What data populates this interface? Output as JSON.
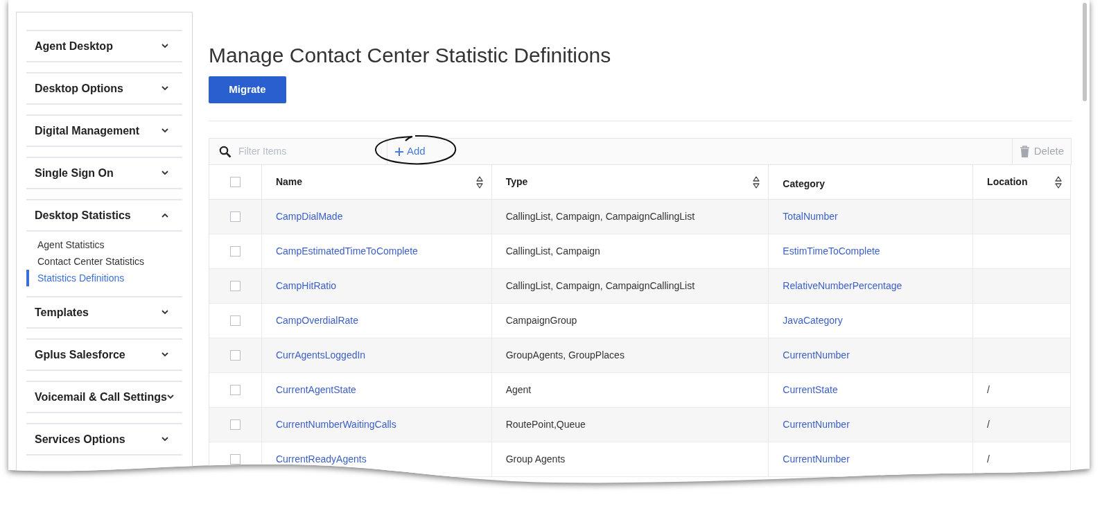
{
  "sidebar": {
    "sections": [
      {
        "label": "Agent Desktop",
        "expanded": false
      },
      {
        "label": "Desktop Options",
        "expanded": false
      },
      {
        "label": "Digital Management",
        "expanded": false
      },
      {
        "label": "Single Sign On",
        "expanded": false
      },
      {
        "label": "Desktop Statistics",
        "expanded": true,
        "children": [
          {
            "label": "Agent Statistics",
            "selected": false
          },
          {
            "label": "Contact Center Statistics",
            "selected": false
          },
          {
            "label": "Statistics Definitions",
            "selected": true
          }
        ]
      },
      {
        "label": "Templates",
        "expanded": false
      },
      {
        "label": "Gplus Salesforce",
        "expanded": false
      },
      {
        "label": "Voicemail & Call Settings",
        "expanded": false
      },
      {
        "label": "Services Options",
        "expanded": false
      }
    ]
  },
  "page": {
    "title": "Manage Contact Center Statistic Definitions",
    "migrate_button": "Migrate"
  },
  "toolbar": {
    "filter_placeholder": "Filter Items",
    "add_button": "Add",
    "delete_button": "Delete",
    "delete_disabled": true
  },
  "table": {
    "select_all_checked": false,
    "columns": [
      {
        "label": "Name",
        "sortable": true
      },
      {
        "label": "Type",
        "sortable": true
      },
      {
        "label": "Category",
        "sortable": false
      },
      {
        "label": "Location",
        "sortable": true
      }
    ],
    "rows": [
      {
        "checked": false,
        "name": "CampDialMade",
        "type": "CallingList, Campaign, CampaignCallingList",
        "category": "TotalNumber",
        "location": ""
      },
      {
        "checked": false,
        "name": "CampEstimatedTimeToComplete",
        "type": "CallingList, Campaign",
        "category": "EstimTimeToComplete",
        "location": ""
      },
      {
        "checked": false,
        "name": "CampHitRatio",
        "type": "CallingList, Campaign, CampaignCallingList",
        "category": "RelativeNumberPercentage",
        "location": ""
      },
      {
        "checked": false,
        "name": "CampOverdialRate",
        "type": "CampaignGroup",
        "category": "JavaCategory",
        "location": ""
      },
      {
        "checked": false,
        "name": "CurrAgentsLoggedIn",
        "type": "GroupAgents, GroupPlaces",
        "category": "CurrentNumber",
        "location": ""
      },
      {
        "checked": false,
        "name": "CurrentAgentState",
        "type": "Agent",
        "category": "CurrentState",
        "location": "/"
      },
      {
        "checked": false,
        "name": "CurrentNumberWaitingCalls",
        "type": "RoutePoint,Queue",
        "category": "CurrentNumber",
        "location": "/"
      },
      {
        "checked": false,
        "name": "CurrentReadyAgents",
        "type": "Group Agents",
        "category": "CurrentNumber",
        "location": "/"
      }
    ]
  }
}
